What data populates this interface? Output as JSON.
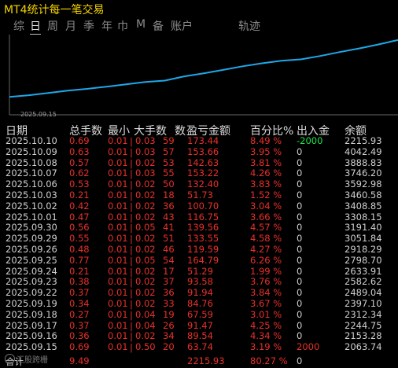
{
  "title": "MT4统计每一笔交易",
  "tabs": [
    "综",
    "日",
    "周",
    "月",
    "季",
    "年",
    "巾",
    "M",
    "备",
    "账户",
    "轨迹"
  ],
  "active_tab": "日",
  "chart": {
    "date_label": "2025.09.15",
    "line_color": "#1ea8e8"
  },
  "headers": {
    "date": "日期",
    "total_lots": "总手数",
    "min_lot": "最小",
    "max_lot": "大手数",
    "count": "数",
    "pnl": "盈亏金额",
    "pct": "百分比%",
    "flow": "出入金",
    "balance": "余额"
  },
  "rows": [
    {
      "date": "2025.10.10",
      "lots": "0.69",
      "min": "0.01",
      "max": "0.03",
      "n": "59",
      "pnl": "173.44",
      "pct": "8.49 %",
      "flow": "-2000",
      "bal": "2215.93"
    },
    {
      "date": "2025.10.09",
      "lots": "0.63",
      "min": "0.01",
      "max": "0.03",
      "n": "57",
      "pnl": "153.66",
      "pct": "3.95 %",
      "flow": "0",
      "bal": "4042.49"
    },
    {
      "date": "2025.10.08",
      "lots": "0.57",
      "min": "0.01",
      "max": "0.02",
      "n": "53",
      "pnl": "142.63",
      "pct": "3.81 %",
      "flow": "0",
      "bal": "3888.83"
    },
    {
      "date": "2025.10.07",
      "lots": "0.62",
      "min": "0.01",
      "max": "0.03",
      "n": "55",
      "pnl": "153.22",
      "pct": "4.26 %",
      "flow": "0",
      "bal": "3746.20"
    },
    {
      "date": "2025.10.06",
      "lots": "0.53",
      "min": "0.01",
      "max": "0.02",
      "n": "50",
      "pnl": "132.40",
      "pct": "3.83 %",
      "flow": "0",
      "bal": "3592.98"
    },
    {
      "date": "2025.10.03",
      "lots": "0.21",
      "min": "0.01",
      "max": "0.02",
      "n": "18",
      "pnl": "51.73",
      "pct": "1.52 %",
      "flow": "0",
      "bal": "3460.58"
    },
    {
      "date": "2025.10.02",
      "lots": "0.42",
      "min": "0.01",
      "max": "0.02",
      "n": "36",
      "pnl": "100.70",
      "pct": "3.04 %",
      "flow": "0",
      "bal": "3408.85"
    },
    {
      "date": "2025.10.01",
      "lots": "0.47",
      "min": "0.01",
      "max": "0.02",
      "n": "43",
      "pnl": "116.75",
      "pct": "3.66 %",
      "flow": "0",
      "bal": "3308.15"
    },
    {
      "date": "2025.09.30",
      "lots": "0.56",
      "min": "0.01",
      "max": "0.05",
      "n": "41",
      "pnl": "139.56",
      "pct": "4.57 %",
      "flow": "0",
      "bal": "3191.40"
    },
    {
      "date": "2025.09.29",
      "lots": "0.55",
      "min": "0.01",
      "max": "0.02",
      "n": "51",
      "pnl": "133.55",
      "pct": "4.58 %",
      "flow": "0",
      "bal": "3051.84"
    },
    {
      "date": "2025.09.26",
      "lots": "0.48",
      "min": "0.01",
      "max": "0.02",
      "n": "46",
      "pnl": "119.59",
      "pct": "4.27 %",
      "flow": "0",
      "bal": "2918.29"
    },
    {
      "date": "2025.09.25",
      "lots": "0.77",
      "min": "0.01",
      "max": "0.05",
      "n": "54",
      "pnl": "164.79",
      "pct": "6.26 %",
      "flow": "0",
      "bal": "2798.70"
    },
    {
      "date": "2025.09.24",
      "lots": "0.21",
      "min": "0.01",
      "max": "0.02",
      "n": "17",
      "pnl": "51.29",
      "pct": "1.99 %",
      "flow": "0",
      "bal": "2633.91"
    },
    {
      "date": "2025.09.23",
      "lots": "0.38",
      "min": "0.01",
      "max": "0.02",
      "n": "37",
      "pnl": "93.58",
      "pct": "3.76 %",
      "flow": "0",
      "bal": "2582.62"
    },
    {
      "date": "2025.09.22",
      "lots": "0.37",
      "min": "0.01",
      "max": "0.02",
      "n": "36",
      "pnl": "91.94",
      "pct": "3.84 %",
      "flow": "0",
      "bal": "2489.04"
    },
    {
      "date": "2025.09.19",
      "lots": "0.34",
      "min": "0.01",
      "max": "0.02",
      "n": "33",
      "pnl": "84.76",
      "pct": "3.67 %",
      "flow": "0",
      "bal": "2397.10"
    },
    {
      "date": "2025.09.18",
      "lots": "0.27",
      "min": "0.01",
      "max": "0.04",
      "n": "19",
      "pnl": "67.59",
      "pct": "3.01 %",
      "flow": "0",
      "bal": "2312.34"
    },
    {
      "date": "2025.09.17",
      "lots": "0.37",
      "min": "0.01",
      "max": "0.04",
      "n": "26",
      "pnl": "91.47",
      "pct": "4.25 %",
      "flow": "0",
      "bal": "2244.75"
    },
    {
      "date": "2025.09.16",
      "lots": "0.36",
      "min": "0.01",
      "max": "0.02",
      "n": "34",
      "pnl": "89.54",
      "pct": "4.34 %",
      "flow": "0",
      "bal": "2153.28"
    },
    {
      "date": "2025.09.15",
      "lots": "0.69",
      "min": "0.01",
      "max": "0.50",
      "n": "20",
      "pnl": "63.74",
      "pct": "3.19 %",
      "flow": "2000",
      "bal": "2063.74"
    }
  ],
  "total": {
    "label": "合计",
    "lots": "9.49",
    "pnl": "2215.93",
    "pct": "80.27 %",
    "flow": "0"
  },
  "watermark": "汇股跨栅"
}
